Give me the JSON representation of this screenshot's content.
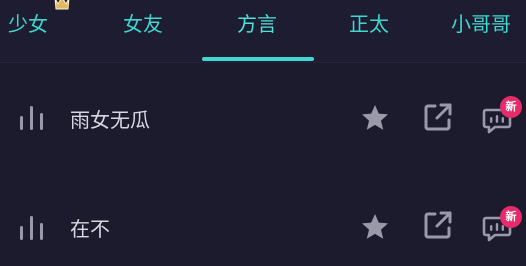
{
  "tabs": [
    {
      "label": "少女",
      "active": false
    },
    {
      "label": "女友",
      "active": false
    },
    {
      "label": "方言",
      "active": true
    },
    {
      "label": "正太",
      "active": false
    },
    {
      "label": "小哥哥",
      "active": false
    }
  ],
  "colors": {
    "background": "#1c1b2e",
    "accent": "#3fd7cf",
    "text": "#d8d7e2",
    "icon": "#9a99aa",
    "badge": "#e62a6a",
    "crown": "#e0b860"
  },
  "rows": [
    {
      "title": "雨女无瓜",
      "badge": "新"
    },
    {
      "title": "在不",
      "badge": "新"
    }
  ],
  "icons": {
    "bars": "audio-bars-icon",
    "star": "star-icon",
    "share": "share-icon",
    "chat": "chat-icon",
    "crown": "crown-icon"
  }
}
